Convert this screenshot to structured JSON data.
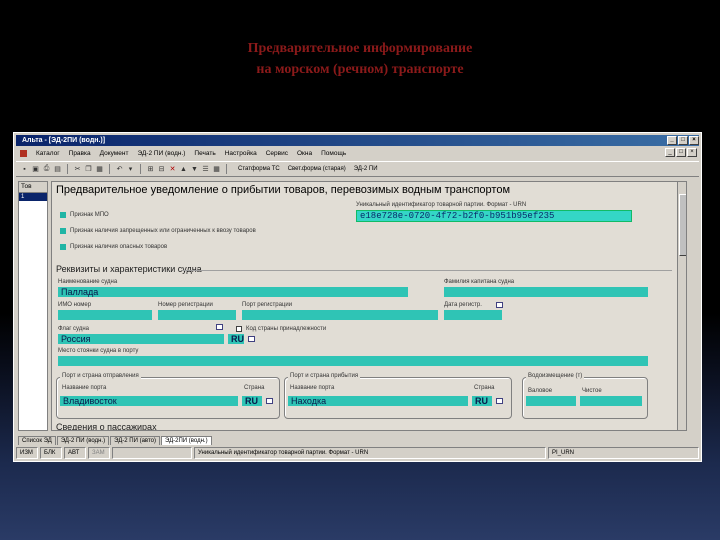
{
  "slide": {
    "title_line1": "Предварительное информирование",
    "title_line2": "на морском (речном) транспорте"
  },
  "window": {
    "title": "Альта - [ЭД-2ПИ (водн.)]",
    "controls": [
      "_",
      "□",
      "×"
    ]
  },
  "menu": [
    "Каталог",
    "Правка",
    "Документ",
    "ЭД-2 ПИ (водн.)",
    "Печать",
    "Настройка",
    "Сервис",
    "Окна",
    "Помощь"
  ],
  "toolbar": {
    "text1": "Статформа ТС",
    "text2": "Свет.форма (старая)",
    "text3": "ЭД-2 ПИ"
  },
  "left_panel": {
    "header": "Тов",
    "row": "1"
  },
  "form": {
    "title": "Предварительное уведомление о прибытии товаров, перевозимых водным транспортом",
    "checkboxes": [
      "Признак МПО",
      "Признак наличия запрещенных или ограниченных к ввозу товаров",
      "Признак наличия опасных товаров"
    ],
    "urn_label": "Уникальный идентификатор товарной партии. Формат - URN",
    "urn_value": "e18e728e-0720-4f72-b2f0-b951b95ef235",
    "vessel_section": "Реквизиты и характеристики судна",
    "vessel_name_label": "Наименование судна",
    "vessel_name": "Паллада",
    "captain_label": "Фамилия капитана судна",
    "imo_label": "ИМО номер",
    "reg_number_label": "Номер регистрации",
    "reg_port_label": "Порт регистрации",
    "reg_date_label": "Дата регистр.",
    "flag_label": "Флаг судна",
    "flag_value": "Россия",
    "flag_code": "RU",
    "cabotage_label": "Код страны принадлежности",
    "berth_label": "Место стоянки судна в порту",
    "departure_group": "Порт и страна отправления",
    "dep_port_label": "Название порта",
    "dep_port": "Владивосток",
    "dep_country_label": "Страна",
    "dep_country": "RU",
    "arrival_group": "Порт и страна прибытия",
    "arr_port_label": "Название порта",
    "arr_port": "Находка",
    "arr_country_label": "Страна",
    "arr_country": "RU",
    "displacement_group": "Водоизмещение (т)",
    "gross_label": "Валовое",
    "net_label": "Чистое",
    "passengers_section": "Сведения о пассажирах"
  },
  "tabs": [
    "Список ЭД",
    "ЭД-2 ПИ (водн.)",
    "ЭД-2 ПИ (авто)",
    "ЭД-2ПИ (водн.)"
  ],
  "statusbar": {
    "seg1": "ИЗМ",
    "seg2": "БЛК",
    "seg3": "АВТ",
    "seg4": "ЗАМ",
    "hint": "Уникальный идентификатор товарной партии. Формат - URN",
    "field": "PI_URN"
  }
}
